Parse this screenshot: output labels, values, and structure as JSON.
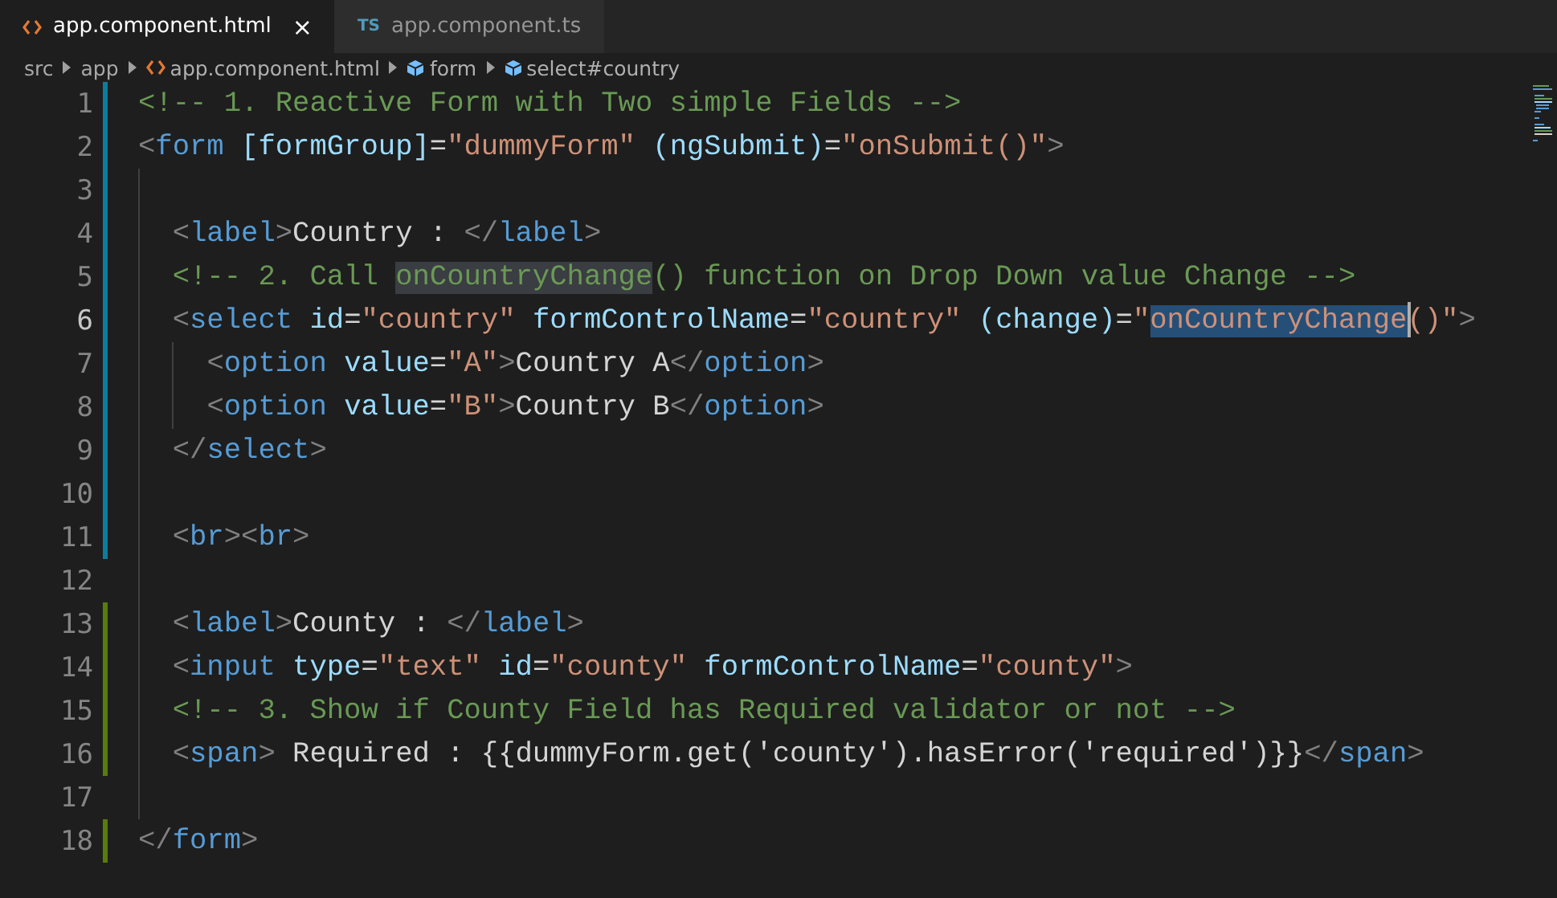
{
  "tabs": [
    {
      "label": "app.component.html",
      "kind": "html",
      "close": "×",
      "selected": true
    },
    {
      "label": "app.component.ts",
      "kind": "ts",
      "icon_text": "TS",
      "selected": false
    }
  ],
  "breadcrumb": [
    {
      "label": "src",
      "kind": "folder"
    },
    {
      "label": "app",
      "kind": "folder"
    },
    {
      "label": "app.component.html",
      "kind": "file"
    },
    {
      "label": "form",
      "kind": "symbol"
    },
    {
      "label": "select#country",
      "kind": "symbol"
    }
  ],
  "lines": [
    {
      "number": "1",
      "kind": "modified",
      "current": false,
      "tokens": [
        {
          "kind": "comment",
          "text": "<!-- 1. Reactive Form with Two simple Fields -->"
        }
      ]
    },
    {
      "number": "2",
      "kind": "modified",
      "current": false,
      "tokens": [
        {
          "kind": "punct",
          "text": "<"
        },
        {
          "kind": "tag",
          "text": "form"
        },
        {
          "kind": "attr",
          "text": " [formGroup]"
        },
        {
          "kind": "plain",
          "text": "="
        },
        {
          "kind": "str",
          "text": "\"dummyForm\""
        },
        {
          "kind": "attr",
          "text": " (ngSubmit)"
        },
        {
          "kind": "plain",
          "text": "="
        },
        {
          "kind": "str",
          "text": "\"onSubmit()\""
        },
        {
          "kind": "punct",
          "text": ">"
        }
      ]
    },
    {
      "number": "3",
      "kind": "modified",
      "current": false
    },
    {
      "number": "4",
      "kind": "modified",
      "current": false,
      "tokens": [
        {
          "kind": "punct",
          "text": "  <"
        },
        {
          "kind": "tag",
          "text": "label"
        },
        {
          "kind": "punct",
          "text": ">"
        },
        {
          "kind": "plain",
          "text": "Country : "
        },
        {
          "kind": "punct",
          "text": "</"
        },
        {
          "kind": "tag",
          "text": "label"
        },
        {
          "kind": "punct",
          "text": ">"
        }
      ]
    },
    {
      "number": "5",
      "kind": "modified",
      "current": false,
      "tokens": [
        {
          "kind": "comment",
          "text": "  <!-- 2. Call "
        },
        {
          "kind": "comment",
          "text": "onCountryChange",
          "highlighted": true
        },
        {
          "kind": "comment",
          "text": "() function on Drop Down value Change -->"
        }
      ]
    },
    {
      "number": "6",
      "kind": "modified",
      "current": true,
      "tokens": [
        {
          "kind": "punct",
          "text": "  <"
        },
        {
          "kind": "tag",
          "text": "select"
        },
        {
          "kind": "attr",
          "text": " id"
        },
        {
          "kind": "plain",
          "text": "="
        },
        {
          "kind": "str",
          "text": "\"country\""
        },
        {
          "kind": "attr",
          "text": " formControlName"
        },
        {
          "kind": "plain",
          "text": "="
        },
        {
          "kind": "str",
          "text": "\"country\""
        },
        {
          "kind": "attr",
          "text": " (change)"
        },
        {
          "kind": "plain",
          "text": "="
        },
        {
          "kind": "str",
          "text": "\""
        },
        {
          "kind": "str",
          "text": "onCountryChange",
          "selected": true
        },
        {
          "kind": "str",
          "text": "()\""
        },
        {
          "kind": "punct",
          "text": ">"
        }
      ]
    },
    {
      "number": "7",
      "kind": "modified",
      "current": false,
      "tokens": [
        {
          "kind": "punct",
          "text": "    <"
        },
        {
          "kind": "tag",
          "text": "option"
        },
        {
          "kind": "attr",
          "text": " value"
        },
        {
          "kind": "plain",
          "text": "="
        },
        {
          "kind": "str",
          "text": "\"A\""
        },
        {
          "kind": "punct",
          "text": ">"
        },
        {
          "kind": "plain",
          "text": "Country A"
        },
        {
          "kind": "punct",
          "text": "</"
        },
        {
          "kind": "tag",
          "text": "option"
        },
        {
          "kind": "punct",
          "text": ">"
        }
      ]
    },
    {
      "number": "8",
      "kind": "modified",
      "current": false,
      "tokens": [
        {
          "kind": "punct",
          "text": "    <"
        },
        {
          "kind": "tag",
          "text": "option"
        },
        {
          "kind": "attr",
          "text": " value"
        },
        {
          "kind": "plain",
          "text": "="
        },
        {
          "kind": "str",
          "text": "\"B\""
        },
        {
          "kind": "punct",
          "text": ">"
        },
        {
          "kind": "plain",
          "text": "Country B"
        },
        {
          "kind": "punct",
          "text": "</"
        },
        {
          "kind": "tag",
          "text": "option"
        },
        {
          "kind": "punct",
          "text": ">"
        }
      ]
    },
    {
      "number": "9",
      "kind": "modified",
      "current": false,
      "tokens": [
        {
          "kind": "punct",
          "text": "  </"
        },
        {
          "kind": "tag",
          "text": "select"
        },
        {
          "kind": "punct",
          "text": ">"
        }
      ]
    },
    {
      "number": "10",
      "kind": "modified",
      "current": false
    },
    {
      "number": "11",
      "kind": "modified",
      "current": false,
      "tokens": [
        {
          "kind": "punct",
          "text": "  <"
        },
        {
          "kind": "tag",
          "text": "br"
        },
        {
          "kind": "punct",
          "text": "><"
        },
        {
          "kind": "tag",
          "text": "br"
        },
        {
          "kind": "punct",
          "text": ">"
        }
      ]
    },
    {
      "number": "12",
      "kind": "unchanged",
      "current": false
    },
    {
      "number": "13",
      "kind": "added",
      "current": false,
      "tokens": [
        {
          "kind": "punct",
          "text": "  <"
        },
        {
          "kind": "tag",
          "text": "label"
        },
        {
          "kind": "punct",
          "text": ">"
        },
        {
          "kind": "plain",
          "text": "County : "
        },
        {
          "kind": "punct",
          "text": "</"
        },
        {
          "kind": "tag",
          "text": "label"
        },
        {
          "kind": "punct",
          "text": ">"
        }
      ]
    },
    {
      "number": "14",
      "kind": "added",
      "current": false,
      "tokens": [
        {
          "kind": "punct",
          "text": "  <"
        },
        {
          "kind": "tag",
          "text": "input"
        },
        {
          "kind": "attr",
          "text": " type"
        },
        {
          "kind": "plain",
          "text": "="
        },
        {
          "kind": "str",
          "text": "\"text\""
        },
        {
          "kind": "attr",
          "text": " id"
        },
        {
          "kind": "plain",
          "text": "="
        },
        {
          "kind": "str",
          "text": "\"county\""
        },
        {
          "kind": "attr",
          "text": " formControlName"
        },
        {
          "kind": "plain",
          "text": "="
        },
        {
          "kind": "str",
          "text": "\"county\""
        },
        {
          "kind": "punct",
          "text": ">"
        }
      ]
    },
    {
      "number": "15",
      "kind": "added",
      "current": false,
      "tokens": [
        {
          "kind": "comment",
          "text": "  <!-- 3. Show if County Field has Required validator or not -->"
        }
      ]
    },
    {
      "number": "16",
      "kind": "added",
      "current": false,
      "tokens": [
        {
          "kind": "punct",
          "text": "  <"
        },
        {
          "kind": "tag",
          "text": "span"
        },
        {
          "kind": "punct",
          "text": ">"
        },
        {
          "kind": "plain",
          "text": " Required : {{dummyForm.get('county').hasError('required')}}"
        },
        {
          "kind": "punct",
          "text": "</"
        },
        {
          "kind": "tag",
          "text": "span"
        },
        {
          "kind": "punct",
          "text": ">"
        }
      ]
    },
    {
      "number": "17",
      "kind": "unchanged",
      "current": false
    },
    {
      "number": "18",
      "kind": "added",
      "current": false,
      "tokens": [
        {
          "kind": "punct",
          "text": "</"
        },
        {
          "kind": "tag",
          "text": "form"
        },
        {
          "kind": "punct",
          "text": ">"
        }
      ]
    }
  ]
}
